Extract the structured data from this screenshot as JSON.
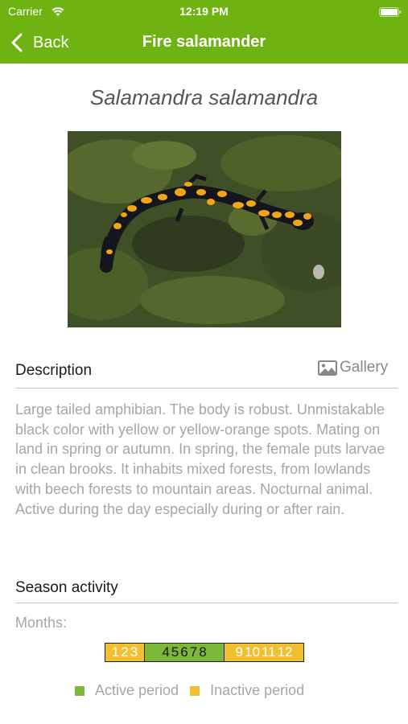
{
  "status": {
    "carrier": "Carrier",
    "time": "12:19 PM"
  },
  "nav": {
    "back_label": "Back",
    "title": "Fire salamander"
  },
  "species": {
    "scientific_name": "Salamandra salamandra"
  },
  "description": {
    "heading": "Description",
    "gallery_label": "Gallery",
    "text": "Large tailed amphibian. The body is robust. Unmistakable black color with yellow or yellow-orange spots. Mating on land in spring or autumn. In spring, the female puts larvae in clean brooks. It inhabits mixed forests, from lowlands with beech forests to mountain areas. Nocturnal animal. Active during the day especially during or after rain."
  },
  "season": {
    "heading": "Season activity",
    "months_label": "Months:",
    "groups": [
      {
        "status": "inactive",
        "months": [
          "1",
          "2",
          "3"
        ]
      },
      {
        "status": "active",
        "months": [
          "4",
          "5",
          "6",
          "7",
          "8"
        ]
      },
      {
        "status": "inactive",
        "months": [
          "9",
          "10",
          "11",
          "12"
        ]
      }
    ],
    "legend": {
      "active": "Active period",
      "inactive": "Inactive period"
    }
  },
  "colors": {
    "bar": "#6fb313",
    "active": "#7cb63a",
    "inactive": "#f0c030"
  },
  "icons": {
    "back": "chevron-left-icon",
    "gallery": "image-icon",
    "wifi": "wifi-icon",
    "battery": "battery-icon"
  }
}
